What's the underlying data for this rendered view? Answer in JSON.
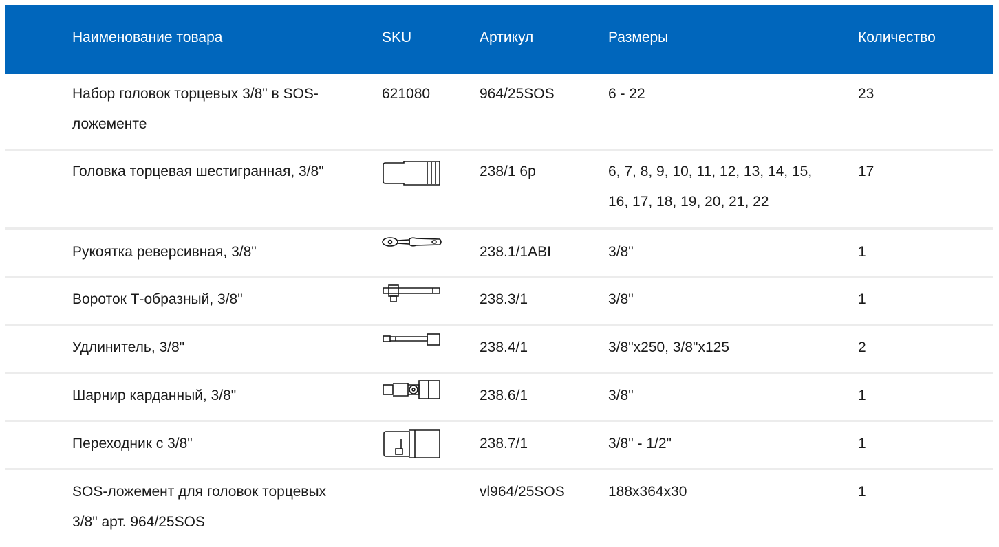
{
  "table": {
    "headers": {
      "name": "Наименование товара",
      "sku": "SKU",
      "article": "Артикул",
      "sizes": "Размеры",
      "qty": "Количество"
    },
    "rows": [
      {
        "name": "Набор головок торцевых 3/8\" в SOS-ложементе",
        "sku": "621080",
        "sku_icon": "",
        "article": "964/25SOS",
        "sizes": "6 - 22",
        "qty": "23"
      },
      {
        "name": "Головка торцевая шестигранная, 3/8\"",
        "sku": "",
        "sku_icon": "socket-icon",
        "article": "238/1 6р",
        "sizes": "6, 7, 8, 9, 10, 11, 12, 13, 14, 15, 16, 17, 18, 19, 20, 21, 22",
        "qty": "17"
      },
      {
        "name": "Рукоятка реверсивная, 3/8\"",
        "sku": "",
        "sku_icon": "ratchet-icon",
        "article": "238.1/1ABI",
        "sizes": "3/8\"",
        "qty": "1"
      },
      {
        "name": "Вороток Т-образный, 3/8\"",
        "sku": "",
        "sku_icon": "t-handle-icon",
        "article": "238.3/1",
        "sizes": "3/8\"",
        "qty": "1"
      },
      {
        "name": "Удлинитель, 3/8\"",
        "sku": "",
        "sku_icon": "extension-bar-icon",
        "article": "238.4/1",
        "sizes": "3/8\"x250, 3/8\"x125",
        "qty": "2"
      },
      {
        "name": "Шарнир карданный, 3/8\"",
        "sku": "",
        "sku_icon": "universal-joint-icon",
        "article": "238.6/1",
        "sizes": "3/8\"",
        "qty": "1"
      },
      {
        "name": "Переходник с 3/8\"",
        "sku": "",
        "sku_icon": "adapter-icon",
        "article": "238.7/1",
        "sizes": "3/8\" - 1/2\"",
        "qty": "1"
      },
      {
        "name": "SOS-ложемент для головок торцевых 3/8\" арт. 964/25SOS",
        "sku": "",
        "sku_icon": "",
        "article": "vl964/25SOS",
        "sizes": "188x364x30",
        "qty": "1"
      }
    ]
  },
  "colors": {
    "header_background": "#0066bc",
    "header_text": "#ffffff",
    "row_divider": "#ececec",
    "body_text": "#1a1a1a"
  }
}
